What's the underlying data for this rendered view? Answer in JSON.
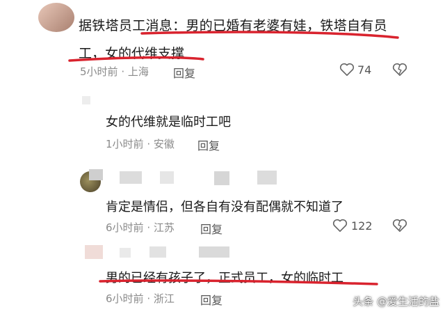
{
  "comments": [
    {
      "text_line1": "据铁塔员工消息：男的已婚有老婆有娃，铁塔自有员",
      "text_line2": "工，女的代维支撑",
      "time": "5小时前",
      "location": "上海",
      "reply": "回复",
      "likes": "74"
    },
    {
      "text": "女的代维就是临时工吧",
      "time": "1小时前",
      "location": "安徽",
      "reply": "回复"
    },
    {
      "text": "肯定是情侣，但各自有没有配偶就不知道了",
      "time": "6小时前",
      "location": "江苏",
      "reply": "回复",
      "likes": "122"
    },
    {
      "text": "男的已经有孩子了，正式员工，女的临时工",
      "time": "6小时前",
      "location": "浙江",
      "reply": "回复"
    }
  ],
  "separator": "·",
  "watermark": "头条 @爱生活的盐",
  "colors": {
    "underline": "#d9232e",
    "meta": "#8a8a8a",
    "text": "#1a1a1a"
  },
  "icons": [
    "heart-icon",
    "broken-heart-icon"
  ]
}
